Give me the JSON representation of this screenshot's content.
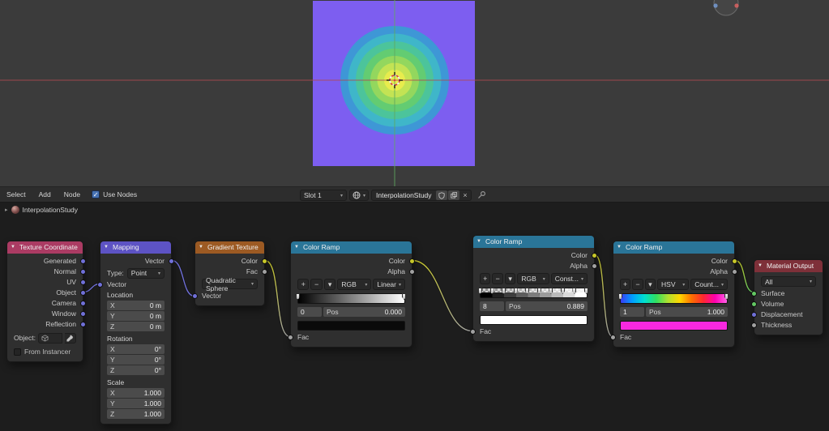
{
  "colors": {
    "socket_vector": "#7070d8",
    "socket_color": "#c7c729",
    "socket_float": "#a1a1a1",
    "socket_shader": "#63c763",
    "accent_blue": "#4772b3"
  },
  "viewport": {
    "plane_color": "#7d5ef0",
    "rings": [
      "#3e97d6",
      "#3fb6c9",
      "#4cc49b",
      "#63cc72",
      "#93d75e",
      "#c3e354",
      "#e8ec4d"
    ],
    "axis_x": "#b04a50",
    "axis_y": "#5fa85f"
  },
  "toolbar": {
    "menu_select": "Select",
    "menu_add": "Add",
    "menu_node": "Node",
    "use_nodes": "Use Nodes",
    "slot": "Slot 1",
    "material_name": "InterpolationStudy"
  },
  "breadcrumb": {
    "material": "InterpolationStudy"
  },
  "nodes": {
    "tex_coord": {
      "title": "Texture Coordinate",
      "header_style": "background:#ab3b63",
      "outputs": [
        "Generated",
        "Normal",
        "UV",
        "Object",
        "Camera",
        "Window",
        "Reflection"
      ],
      "object_label": "Object:",
      "from_instancer": "From Instancer"
    },
    "mapping": {
      "title": "Mapping",
      "header_style": "background:#5d53c4",
      "output": "Vector",
      "type_label": "Type:",
      "type_value": "Point",
      "input": "Vector",
      "axis_x": "X",
      "axis_y": "Y",
      "axis_z": "Z",
      "location": {
        "label": "Location",
        "x": "0 m",
        "y": "0 m",
        "z": "0 m"
      },
      "rotation": {
        "label": "Rotation",
        "x": "0°",
        "y": "0°",
        "z": "0°"
      },
      "scale": {
        "label": "Scale",
        "x": "1.000",
        "y": "1.000",
        "z": "1.000"
      }
    },
    "gradient_tex": {
      "title": "Gradient Texture",
      "header_style": "background:#9c5a23",
      "out_color": "Color",
      "out_fac": "Fac",
      "type_value": "Quadratic Sphere",
      "input": "Vector"
    },
    "ramp1": {
      "title": "Color Ramp",
      "header_style": "background:#2a7598",
      "out_color": "Color",
      "out_alpha": "Alpha",
      "btn_add": "+",
      "btn_del": "−",
      "btn_more": "▾",
      "mode": "RGB",
      "interp": "Linear",
      "index": "0",
      "pos_label": "Pos",
      "pos_value": "0.000",
      "input": "Fac",
      "bar_style": "background:linear-gradient(90deg,#000,#fff)",
      "swatch_style": "background:#0a0a0a",
      "markers": [
        0,
        100
      ]
    },
    "ramp2": {
      "title": "Color Ramp",
      "header_style": "background:#2a7598",
      "out_color": "Color",
      "out_alpha": "Alpha",
      "btn_add": "+",
      "btn_del": "−",
      "btn_more": "▾",
      "mode": "RGB",
      "interp": "Const...",
      "index": "8",
      "pos_label": "Pos",
      "pos_value": "0.889",
      "input": "Fac",
      "bar_style": "background:linear-gradient(90deg,#000 0 11.2%,#1f1f1f 0 22.3%,#3e3e3e 0 33.4%,#5d5d5d 0 44.5%,#7c7c7c 0 55.6%,#9b9b9b 0 66.7%,#bababa 0 77.8%,#d9d9d9 0 88.9%,#fff 0) 0 100%/100% 55% no-repeat,linear-gradient(90deg,rgba(255,255,255,0),rgba(255,255,255,.95)),repeating-conic-gradient(#c8c8c8 0% 25%,#838383 0% 50%) 0 0/6px 6px",
      "swatch_style": "background:#ffffff",
      "markers": [
        0,
        11.1,
        22.2,
        33.3,
        44.4,
        55.6,
        66.7,
        77.8,
        88.9,
        100
      ]
    },
    "ramp3": {
      "title": "Color Ramp",
      "header_style": "background:#2a7598",
      "out_color": "Color",
      "out_alpha": "Alpha",
      "btn_add": "+",
      "btn_del": "−",
      "btn_more": "▾",
      "mode": "HSV",
      "interp": "Count...",
      "index": "1",
      "pos_label": "Pos",
      "pos_value": "1.000",
      "input": "Fac",
      "bar_style": "background:linear-gradient(90deg,#3a3af5,#00a0ff,#00e0d0,#30e060,#b0e030,#ffd800,#ff7000,#ff2830,#ff00b0,#ff60e8)",
      "swatch_style": "background:#f928e0",
      "markers": [
        0,
        100
      ]
    },
    "mat_output": {
      "title": "Material Output",
      "header_style": "background:#7e3039",
      "target": "All",
      "inputs": [
        "Surface",
        "Volume",
        "Displacement",
        "Thickness"
      ]
    }
  }
}
